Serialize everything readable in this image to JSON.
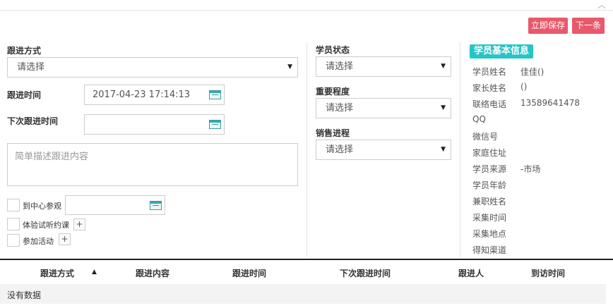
{
  "toolbar": {
    "save_label": "立即保存",
    "next_label": "下一条"
  },
  "form": {
    "follow_method_label": "跟进方式",
    "follow_method_value": "请选择",
    "follow_time_label": "跟进时间",
    "follow_time_value": "2017-04-23 17:14:13",
    "next_follow_time_label": "下次跟进时间",
    "next_follow_time_value": "",
    "content_placeholder": "简单描述跟进内容",
    "visit_center_label": "到中心参观",
    "trial_class_label": "体验试听约课",
    "activity_label": "参加活动",
    "plus": "+"
  },
  "status": {
    "student_status_label": "学员状态",
    "student_status_value": "请选择",
    "importance_label": "重要程度",
    "importance_value": "请选择",
    "sales_progress_label": "销售进程",
    "sales_progress_value": "请选择"
  },
  "info": {
    "title": "学员基本信息",
    "rows": [
      {
        "key": "学员姓名",
        "value": "佳佳()"
      },
      {
        "key": "家长姓名",
        "value": "()"
      },
      {
        "key": "联络电话",
        "value": "13589641478"
      },
      {
        "key": "QQ",
        "value": ""
      },
      {
        "key": "微信号",
        "value": ""
      },
      {
        "key": "家庭住址",
        "value": ""
      },
      {
        "key": "学员来源",
        "value": "-市场"
      },
      {
        "key": "学员年龄",
        "value": ""
      },
      {
        "key": "兼职姓名",
        "value": ""
      },
      {
        "key": "采集时间",
        "value": ""
      },
      {
        "key": "采集地点",
        "value": ""
      },
      {
        "key": "得知渠道",
        "value": ""
      }
    ]
  },
  "table": {
    "columns": [
      "跟进方式",
      "跟进内容",
      "跟进时间",
      "下次跟进时间",
      "跟进人",
      "到访时间"
    ],
    "empty_text": "没有数据"
  }
}
